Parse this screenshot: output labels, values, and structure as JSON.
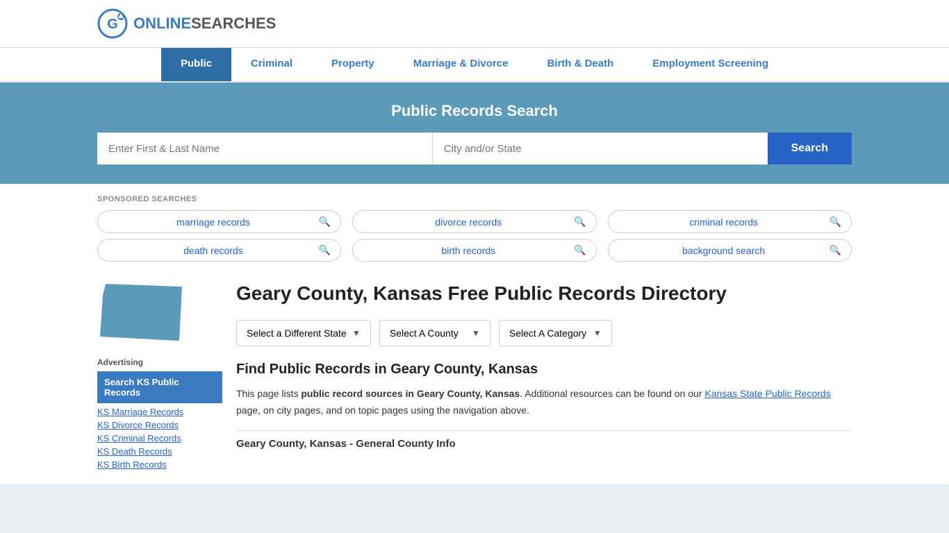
{
  "header": {
    "logo_text_bold": "ONLINE",
    "logo_text_light": "SEARCHES"
  },
  "nav": {
    "items": [
      {
        "label": "Public",
        "active": true
      },
      {
        "label": "Criminal",
        "active": false
      },
      {
        "label": "Property",
        "active": false
      },
      {
        "label": "Marriage & Divorce",
        "active": false
      },
      {
        "label": "Birth & Death",
        "active": false
      },
      {
        "label": "Employment Screening",
        "active": false
      }
    ]
  },
  "search_banner": {
    "title": "Public Records Search",
    "name_placeholder": "Enter First & Last Name",
    "location_placeholder": "City and/or State",
    "button_label": "Search"
  },
  "sponsored": {
    "label": "SPONSORED SEARCHES",
    "items": [
      {
        "text": "marriage records"
      },
      {
        "text": "divorce records"
      },
      {
        "text": "criminal records"
      },
      {
        "text": "death records"
      },
      {
        "text": "birth records"
      },
      {
        "text": "background search"
      }
    ]
  },
  "page": {
    "title": "Geary County, Kansas Free Public Records Directory",
    "dropdowns": {
      "state": "Select a Different State",
      "county": "Select A County",
      "category": "Select A Category"
    },
    "find_title": "Find Public Records in Geary County, Kansas",
    "find_desc_part1": "This page lists ",
    "find_desc_bold": "public record sources in Geary County, Kansas",
    "find_desc_part2": ". Additional resources can be found on our ",
    "find_desc_link": "Kansas State Public Records",
    "find_desc_part3": " page, on city pages, and on topic pages using the navigation above.",
    "section_sub_title": "Geary County, Kansas - General County Info"
  },
  "sidebar": {
    "ad_label": "Advertising",
    "featured_text": "Search KS Public Records",
    "links": [
      "KS Marriage Records",
      "KS Divorce Records",
      "KS Criminal Records",
      "KS Death Records",
      "KS Birth Records"
    ]
  }
}
